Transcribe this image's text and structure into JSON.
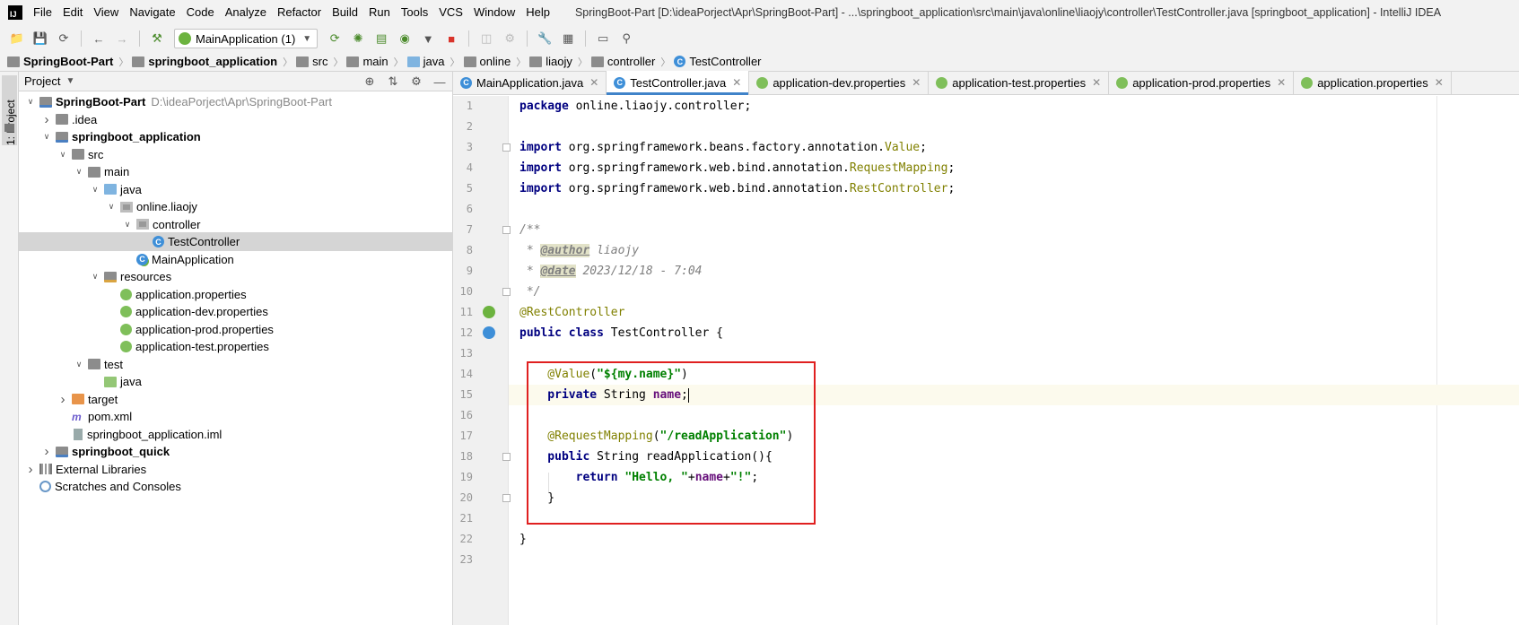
{
  "menubar": {
    "logo": "IJ",
    "items": [
      "File",
      "Edit",
      "View",
      "Navigate",
      "Code",
      "Analyze",
      "Refactor",
      "Build",
      "Run",
      "Tools",
      "VCS",
      "Window",
      "Help"
    ],
    "title": "SpringBoot-Part [D:\\ideaPorject\\Apr\\SpringBoot-Part] - ...\\springboot_application\\src\\main\\java\\online\\liaojy\\controller\\TestController.java [springboot_application] - IntelliJ IDEA"
  },
  "toolbar": {
    "run_config": "MainApplication (1)"
  },
  "breadcrumb": [
    "SpringBoot-Part",
    "springboot_application",
    "src",
    "main",
    "java",
    "online",
    "liaojy",
    "controller",
    "TestController"
  ],
  "stripe": {
    "label": "1: Project"
  },
  "project_panel": {
    "title": "Project",
    "tree": [
      {
        "label": "SpringBoot-Part",
        "path": "D:\\ideaPorject\\Apr\\SpringBoot-Part",
        "bold": true,
        "arrow": "down",
        "icon": "module-folder",
        "depth": 0
      },
      {
        "label": ".idea",
        "arrow": "right",
        "icon": "folder",
        "depth": 1
      },
      {
        "label": "springboot_application",
        "bold": true,
        "arrow": "down",
        "icon": "module-folder",
        "depth": 1
      },
      {
        "label": "src",
        "arrow": "down",
        "icon": "folder",
        "depth": 2
      },
      {
        "label": "main",
        "arrow": "down",
        "icon": "folder",
        "depth": 3
      },
      {
        "label": "java",
        "arrow": "down",
        "icon": "source-folder",
        "depth": 4
      },
      {
        "label": "online.liaojy",
        "arrow": "down",
        "icon": "package",
        "depth": 5
      },
      {
        "label": "controller",
        "arrow": "down",
        "icon": "package",
        "depth": 6
      },
      {
        "label": "TestController",
        "icon": "class",
        "depth": 7,
        "selected": true
      },
      {
        "label": "MainApplication",
        "icon": "spring-class",
        "depth": 6
      },
      {
        "label": "resources",
        "arrow": "down",
        "icon": "resources-folder",
        "depth": 4
      },
      {
        "label": "application.properties",
        "icon": "properties",
        "depth": 5
      },
      {
        "label": "application-dev.properties",
        "icon": "properties",
        "depth": 5
      },
      {
        "label": "application-prod.properties",
        "icon": "properties",
        "depth": 5
      },
      {
        "label": "application-test.properties",
        "icon": "properties",
        "depth": 5
      },
      {
        "label": "test",
        "arrow": "down",
        "icon": "folder",
        "depth": 3
      },
      {
        "label": "java",
        "icon": "test-folder",
        "depth": 4
      },
      {
        "label": "target",
        "arrow": "right",
        "icon": "excluded-folder",
        "depth": 2
      },
      {
        "label": "pom.xml",
        "icon": "maven",
        "depth": 2
      },
      {
        "label": "springboot_application.iml",
        "icon": "iml",
        "depth": 2
      },
      {
        "label": "springboot_quick",
        "bold": true,
        "arrow": "right",
        "icon": "module-folder",
        "depth": 1
      },
      {
        "label": "External Libraries",
        "arrow": "right",
        "icon": "libraries",
        "depth": 0
      },
      {
        "label": "Scratches and Consoles",
        "icon": "scratches",
        "depth": 0
      }
    ]
  },
  "editor": {
    "tabs": [
      {
        "label": "MainApplication.java",
        "icon": "spring-class",
        "active": false
      },
      {
        "label": "TestController.java",
        "icon": "class",
        "active": true
      },
      {
        "label": "application-dev.properties",
        "icon": "properties",
        "active": false
      },
      {
        "label": "application-test.properties",
        "icon": "properties",
        "active": false
      },
      {
        "label": "application-prod.properties",
        "icon": "properties",
        "active": false
      },
      {
        "label": "application.properties",
        "icon": "properties",
        "active": false
      }
    ],
    "line_numbers": [
      "1",
      "2",
      "3",
      "4",
      "5",
      "6",
      "7",
      "8",
      "9",
      "10",
      "11",
      "12",
      "13",
      "14",
      "15",
      "16",
      "17",
      "18",
      "19",
      "20",
      "21",
      "22",
      "23"
    ],
    "code": {
      "l1_kw": "package",
      "l1_rest": " online.liaojy.controller;",
      "l3_kw": "import",
      "l3_rest": " org.springframework.beans.factory.annotation.",
      "l3_ann": "Value",
      "l3_end": ";",
      "l4_kw": "import",
      "l4_rest": " org.springframework.web.bind.annotation.",
      "l4_ann": "RequestMapping",
      "l4_end": ";",
      "l5_kw": "import",
      "l5_rest": " org.springframework.web.bind.annotation.",
      "l5_ann": "RestController",
      "l5_end": ";",
      "l7": "/**",
      "l8_pre": " * ",
      "l8_tag": "@author",
      "l8_val": " liaojy",
      "l9_pre": " * ",
      "l9_tag": "@date",
      "l9_val": " 2023/12/18 - 7:04",
      "l10": " */",
      "l11": "@RestController",
      "l12_kw": "public class",
      "l12_rest": " TestController {",
      "l14_ann": "    @Value",
      "l14_p1": "(",
      "l14_str": "\"${my.name}\"",
      "l14_p2": ")",
      "l15_kw": "    private",
      "l15_type": " String ",
      "l15_field": "name",
      "l15_end": ";",
      "l17_ann": "    @RequestMapping",
      "l17_p1": "(",
      "l17_str": "\"/readApplication\"",
      "l17_p2": ")",
      "l18_kw": "    public",
      "l18_rest": " String readApplication(){",
      "l19_kw": "        return",
      "l19_s1": " \"Hello, \"",
      "l19_plus1": "+",
      "l19_field": "name",
      "l19_plus2": "+",
      "l19_s2": "\"!\"",
      "l19_end": ";",
      "l20": "    }",
      "l22": "}"
    }
  },
  "colors": {
    "keyword": "#000080",
    "annotation": "#808000",
    "string": "#008000",
    "field": "#660e7a",
    "comment": "#808080",
    "highlight_box": "#e02020",
    "selection": "#d5d5d5",
    "active_tab_underline": "#4083c9"
  }
}
